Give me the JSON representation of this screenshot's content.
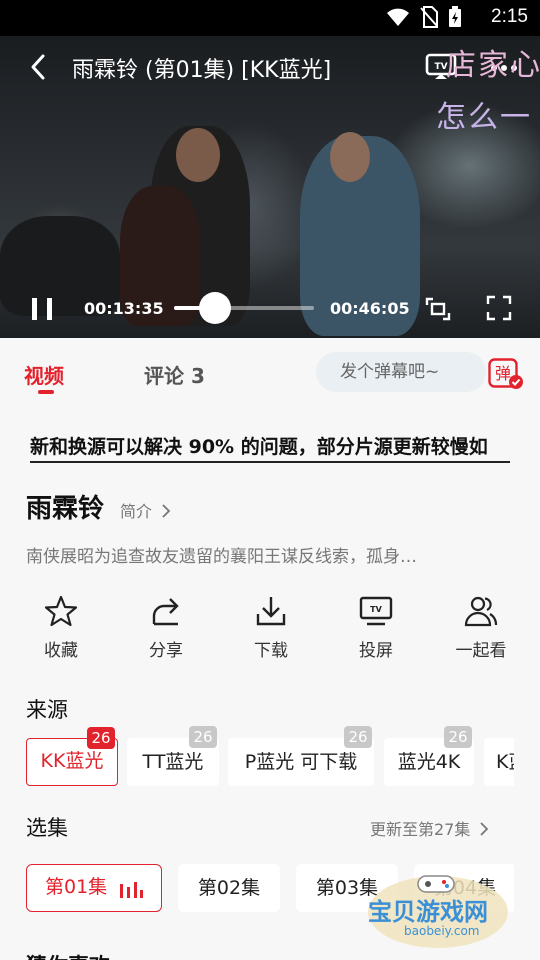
{
  "status_bar": {
    "time": "2:15",
    "icons": [
      "wifi-icon",
      "no-sim-icon",
      "battery-charging-icon"
    ]
  },
  "player": {
    "title": "雨霖铃 (第01集) [KK蓝光]",
    "current_time": "00:13:35",
    "total_time": "00:46:05",
    "progress": 0.295,
    "danmu": [
      "店家心",
      "怎么一"
    ],
    "icons": [
      "back-icon",
      "tv-cast-icon",
      "more-icon",
      "pause-icon",
      "rotate-icon",
      "fullscreen-icon"
    ]
  },
  "tabs": {
    "video": "视频",
    "comments": "评论 3"
  },
  "danmu_input": {
    "placeholder": "发个弹幕吧~",
    "toggle_label": "弹"
  },
  "notice": "新和换源可以解决 90% 的问题，部分片源更新较慢如",
  "show": {
    "title": "雨霖铃",
    "intro_label": "简介",
    "synopsis": "南侠展昭为追查故友遗留的襄阳王谋反线索，孤身…"
  },
  "actions": [
    {
      "label": "收藏",
      "icon": "star-icon"
    },
    {
      "label": "分享",
      "icon": "share-icon"
    },
    {
      "label": "下载",
      "icon": "download-icon"
    },
    {
      "label": "投屏",
      "icon": "tv-icon"
    },
    {
      "label": "一起看",
      "icon": "users-icon"
    }
  ],
  "sources": {
    "heading": "来源",
    "items": [
      {
        "label": "KK蓝光",
        "count": "26",
        "active": true
      },
      {
        "label": "TT蓝光",
        "count": "26"
      },
      {
        "label": "P蓝光 可下载",
        "count": "26"
      },
      {
        "label": "蓝光4K",
        "count": "26"
      },
      {
        "label": "K蓝",
        "count": ""
      }
    ]
  },
  "episodes": {
    "heading": "选集",
    "update_label": "更新至第27集",
    "items": [
      {
        "label": "第01集",
        "active": true
      },
      {
        "label": "第02集"
      },
      {
        "label": "第03集"
      },
      {
        "label": "第04集"
      }
    ]
  },
  "watermark": {
    "title": "宝贝游戏网",
    "domain": "baobeiy.com"
  },
  "next_section": "猜你喜欢",
  "colors": {
    "accent": "#e2232d",
    "badge_grey": "#c8c8c8",
    "background": "#f7f7f7"
  }
}
